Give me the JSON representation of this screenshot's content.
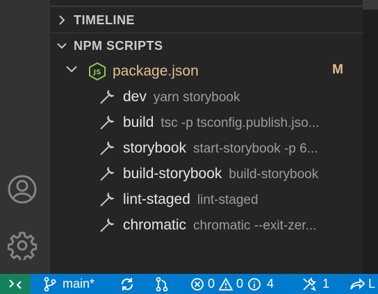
{
  "sidebar": {
    "sections": {
      "timeline": {
        "title": "TIMELINE",
        "expanded": false
      },
      "npm_scripts": {
        "title": "NPM SCRIPTS",
        "expanded": true
      }
    },
    "package": {
      "name": "package.json",
      "badge": "M",
      "icon": "json-file-icon"
    },
    "scripts": [
      {
        "name": "dev",
        "command": "yarn storybook"
      },
      {
        "name": "build",
        "command": "tsc -p tsconfig.publish.jso..."
      },
      {
        "name": "storybook",
        "command": "start-storybook -p 6..."
      },
      {
        "name": "build-storybook",
        "command": "build-storybook"
      },
      {
        "name": "lint-staged",
        "command": "lint-staged"
      },
      {
        "name": "chromatic",
        "command": "chromatic --exit-zer..."
      }
    ]
  },
  "activity_bar": {
    "icons": [
      "account-icon",
      "settings-gear-icon"
    ]
  },
  "status_bar": {
    "branch": "main*",
    "errors": "0",
    "warnings": "0",
    "infos": "4",
    "tools_count": "1",
    "trailing": "L",
    "colors": {
      "background": "#007acc",
      "remote": "#16825d"
    }
  }
}
